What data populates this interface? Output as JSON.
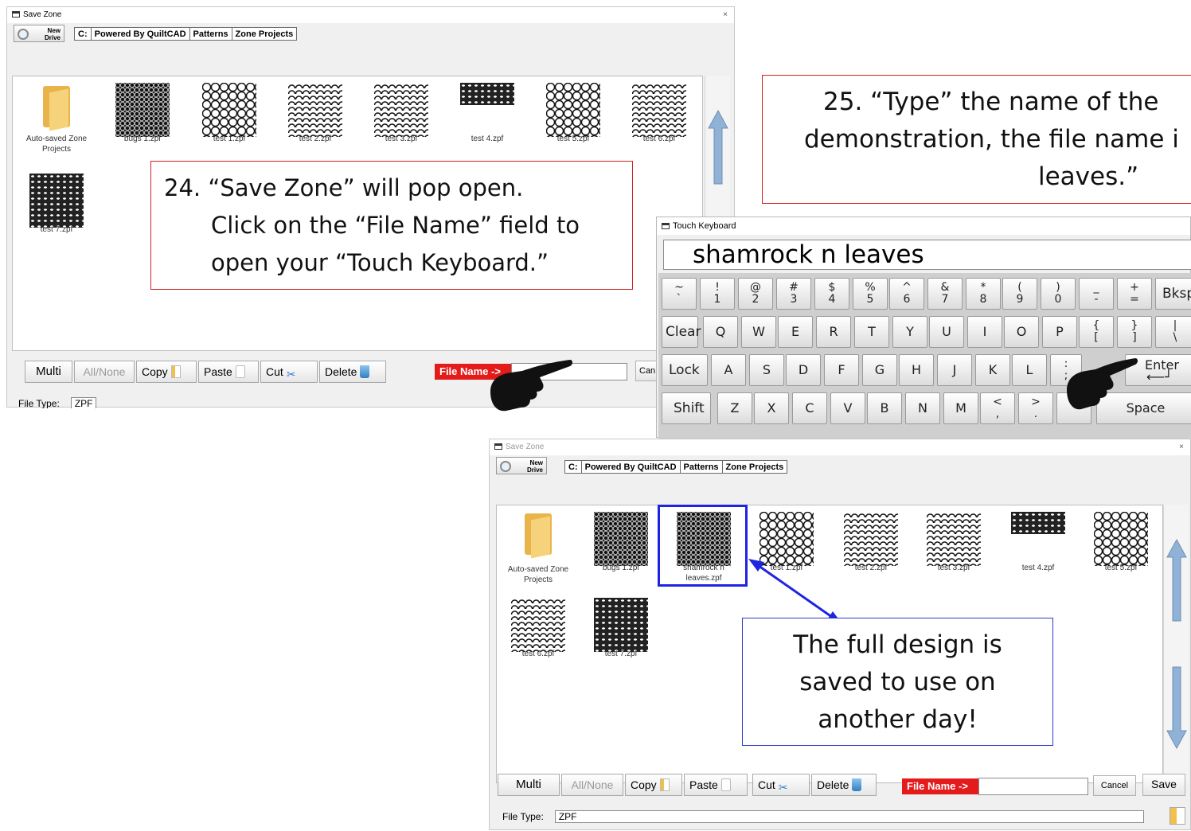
{
  "window1": {
    "title": "Save Zone",
    "new_drive": "New Drive",
    "breadcrumb": [
      "C:",
      "Powered By QuiltCAD",
      "Patterns",
      "Zone Projects"
    ],
    "folder_label": "Auto-saved Zone Projects",
    "files": [
      "bugs 1.zpf",
      "test 1.zpf",
      "test 2.zpf",
      "test 3.zpf",
      "test 4.zpf",
      "test 5.zpf",
      "test 6.zpf",
      "test 7.zpf"
    ],
    "buttons": {
      "multi": "Multi",
      "all_none": "All/None",
      "copy": "Copy",
      "paste": "Paste",
      "cut": "Cut",
      "delete": "Delete"
    },
    "file_name_label": "File Name ->",
    "cancel_partial": "Can",
    "file_type_label": "File Type:",
    "file_type_value": "ZPF"
  },
  "callout24": {
    "line1": "24.  “Save Zone” will pop open.",
    "line2": "Click on the “File Name” field to",
    "line3": "open your “Touch Keyboard.”"
  },
  "callout25": {
    "line1": "25.  “Type” the name of the",
    "line2": "demonstration, the file name i",
    "line3": "leaves.”"
  },
  "keyboard": {
    "title": "Touch Keyboard",
    "input_value": "shamrock n leaves",
    "row1": [
      {
        "top": "~",
        "bot": "`"
      },
      {
        "top": "!",
        "bot": "1"
      },
      {
        "top": "@",
        "bot": "2"
      },
      {
        "top": "#",
        "bot": "3"
      },
      {
        "top": "$",
        "bot": "4"
      },
      {
        "top": "%",
        "bot": "5"
      },
      {
        "top": "^",
        "bot": "6"
      },
      {
        "top": "&",
        "bot": "7"
      },
      {
        "top": "*",
        "bot": "8"
      },
      {
        "top": "(",
        "bot": "9"
      },
      {
        "top": ")",
        "bot": "0"
      },
      {
        "top": "_",
        "bot": "-"
      },
      {
        "top": "+",
        "bot": "="
      }
    ],
    "bksp": "Bksp",
    "clear": "Clear",
    "row2": [
      "Q",
      "W",
      "E",
      "R",
      "T",
      "Y",
      "U",
      "I",
      "O",
      "P"
    ],
    "row2_sym": [
      {
        "top": "{",
        "bot": "["
      },
      {
        "top": "}",
        "bot": "]"
      },
      {
        "top": "|",
        "bot": "\\"
      }
    ],
    "lock": "Lock",
    "row3": [
      "A",
      "S",
      "D",
      "F",
      "G",
      "H",
      "J",
      "K",
      "L"
    ],
    "row3_sym": {
      "top": ":",
      "bot": ";"
    },
    "enter": "Enter",
    "shift": "Shift",
    "row4": [
      "Z",
      "X",
      "C",
      "V",
      "B",
      "N",
      "M"
    ],
    "row4_sym": [
      {
        "top": "<",
        "bot": ","
      },
      {
        "top": ">",
        "bot": "."
      }
    ],
    "space": "Space"
  },
  "window2": {
    "title": "Save Zone",
    "new_drive": "New Drive",
    "breadcrumb": [
      "C:",
      "Powered By QuiltCAD",
      "Patterns",
      "Zone Projects"
    ],
    "folder_label": "Auto-saved Zone Projects",
    "files": [
      "bugs 1.zpf",
      "shamrock n leaves.zpf",
      "test 1.zpf",
      "test 2.zpf",
      "test 3.zpf",
      "test 4.zpf",
      "test 5.zpf",
      "test 6.zpf",
      "test 7.zpf"
    ],
    "buttons": {
      "multi": "Multi",
      "all_none": "All/None",
      "copy": "Copy",
      "paste": "Paste",
      "cut": "Cut",
      "delete": "Delete"
    },
    "file_name_label": "File Name ->",
    "cancel": "Cancel",
    "save": "Save",
    "file_type_label": "File Type:",
    "file_type_value": "ZPF"
  },
  "callout_saved": {
    "line1": "The full design is",
    "line2": "saved to use on",
    "line3": "another day!"
  },
  "colors": {
    "callout_red": "#d32020",
    "callout_blue": "#2a3bd1",
    "file_name_red": "#e31b1b"
  }
}
